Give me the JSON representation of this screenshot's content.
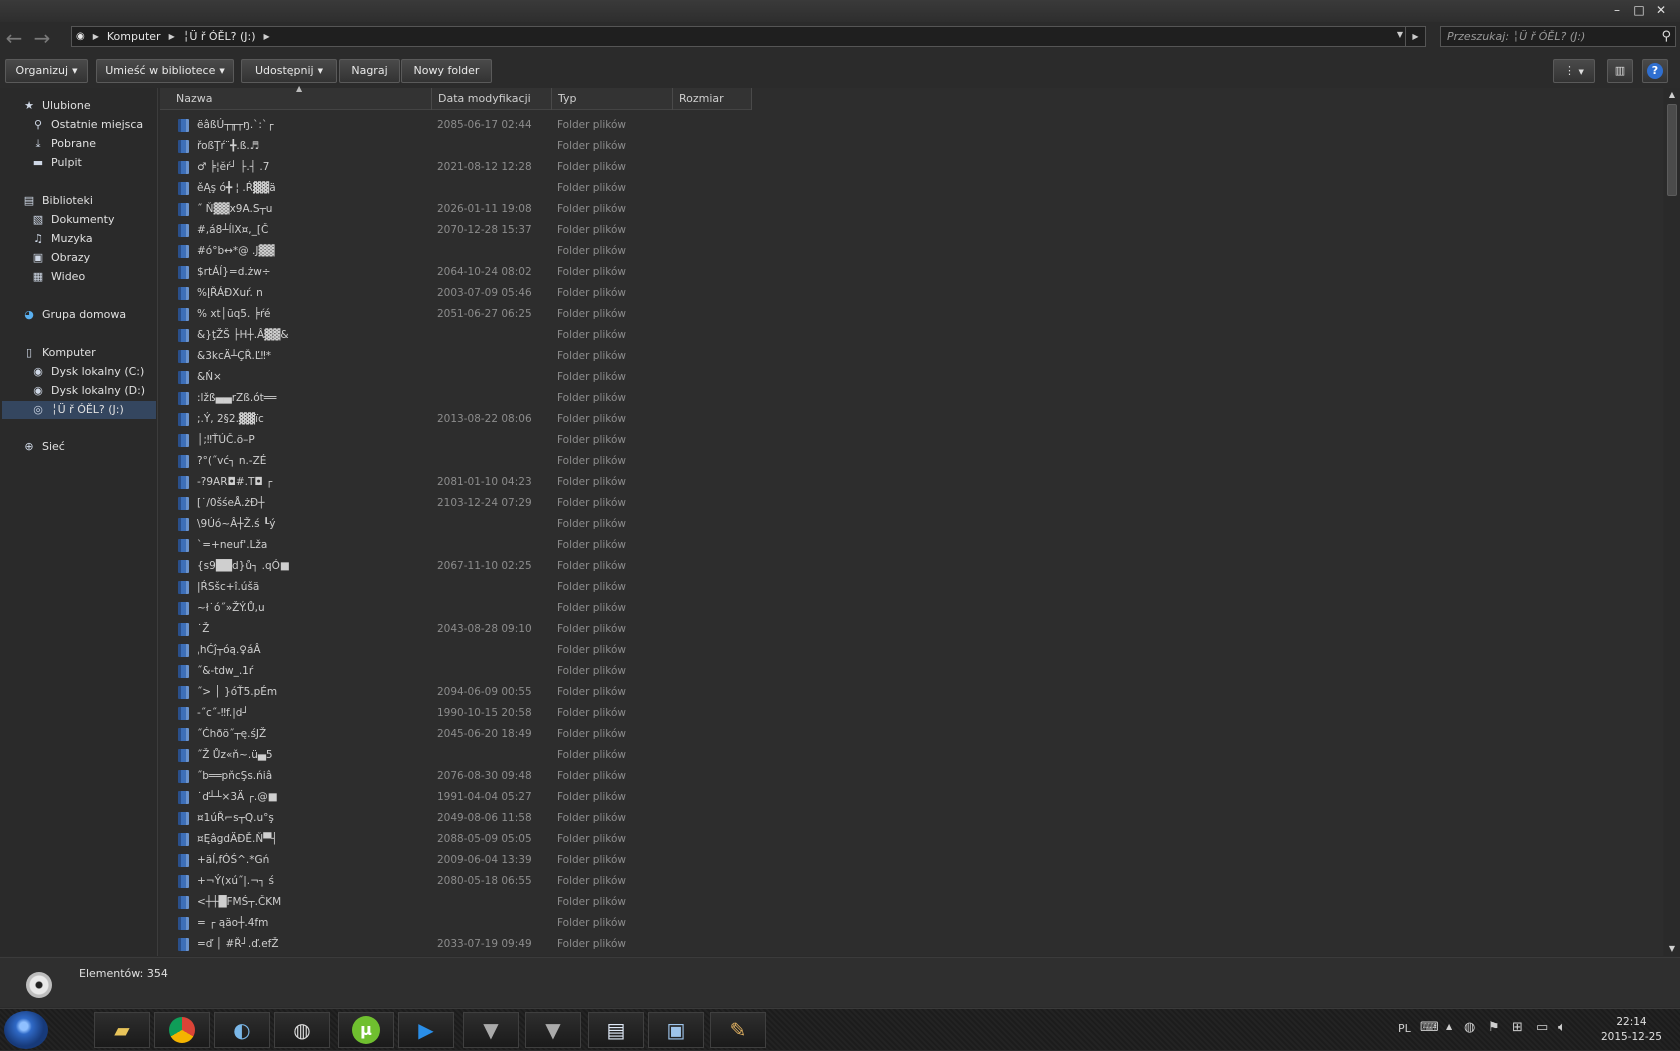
{
  "window": {
    "controls": [
      "–",
      "□",
      "✕"
    ]
  },
  "nav": {
    "back": "←",
    "forward": "→",
    "breadcrumb": [
      "Komputer",
      "╎Ü   ř ÓĚL? (J:)"
    ],
    "search_placeholder": "Przeszukaj: ╎Ü   ř ÓĚL? (J:)"
  },
  "toolbar": {
    "organize": "Organizuj",
    "library": "Umieść w bibliotece",
    "share": "Udostępnij",
    "burn": "Nagraj",
    "new_folder": "Nowy folder"
  },
  "navpane": {
    "favorites": "Ulubione",
    "recent": "Ostatnie miejsca",
    "downloads": "Pobrane",
    "desktop": "Pulpit",
    "libraries": "Biblioteki",
    "documents": "Dokumenty",
    "music": "Muzyka",
    "pictures": "Obrazy",
    "videos": "Wideo",
    "homegroup": "Grupa domowa",
    "computer": "Komputer",
    "disk_c": "Dysk lokalny (C:)",
    "disk_d": "Dysk lokalny (D:)",
    "disk_j": "╎Ü   ř ÓĚL? (J:)",
    "network": "Sieć"
  },
  "columns": {
    "name": "Nazwa",
    "date": "Data modyfikacji",
    "type": "Typ",
    "size": "Rozmiar"
  },
  "rows": [
    {
      "name": "ëâßÚ┬╥┬ŋ.`:`┌",
      "date": "2085-06-17 02:44",
      "type": "Folder plików"
    },
    {
      "name": "řoßŢŕ¨╋.ß.♬",
      "date": "",
      "type": "Folder plików"
    },
    {
      "name": "♂ ╞¦ĕŕ┘ ├.┤ .7",
      "date": "2021-08-12 12:28",
      "type": "Folder plików"
    },
    {
      "name": "ěĄş  ó╋  ¦ .Ŕ▓▓ä",
      "date": "",
      "type": "Folder plików"
    },
    {
      "name": " ˝ Ň▓▓x9A.S┬u",
      "date": "2026-01-11 19:08",
      "type": "Folder plików"
    },
    {
      "name": "#,á8┴ĺlX¤,_[Č",
      "date": "2070-12-28 15:37",
      "type": "Folder plików"
    },
    {
      "name": "#ó°b↔*@  .J▓▓",
      "date": "",
      "type": "Folder plików"
    },
    {
      "name": "$rtÁĺ}=d.żw÷",
      "date": "2064-10-24 08:02",
      "type": "Folder plików"
    },
    {
      "name": "%ĮŘÁĐXuŕ.     n",
      "date": "2003-07-09 05:46",
      "type": "Folder plików"
    },
    {
      "name": "%    xt│ūq5. ╞ŕé",
      "date": "2051-06-27 06:25",
      "type": "Folder plików"
    },
    {
      "name": "&}ţŽŠ ├H┼.Â▓▓&",
      "date": "",
      "type": "Folder plików"
    },
    {
      "name": "&3kcÄ┴ÇŘ.Ľ‼*",
      "date": "",
      "type": "Folder plików"
    },
    {
      "name": "&Ń×",
      "date": "",
      "type": "Folder plików"
    },
    {
      "name": ":lžß▄▄rZß.ót══",
      "date": "",
      "type": "Folder plików"
    },
    {
      "name": ";.Ý, 2§2.▓▓ïc",
      "date": "2013-08-22 08:06",
      "type": "Folder plików"
    },
    {
      "name": "│;‼ŤÚČ.ö–P",
      "date": "",
      "type": "Folder plików"
    },
    {
      "name": "?°(˝vć┐ n.-ZÉ",
      "date": "",
      "type": "Folder plików"
    },
    {
      "name": "-?9AR◘#.T◘ ┌",
      "date": "2081-01-10 04:23",
      "type": "Folder plików"
    },
    {
      "name": "[˙/0šśeÅ.żĐ┼",
      "date": "2103-12-24 07:29",
      "type": "Folder plików"
    },
    {
      "name": "\\9Úó~Â┼Ž.ś ┖ý",
      "date": "",
      "type": "Folder plików"
    },
    {
      "name": "`=+neuf'.Lža",
      "date": "",
      "type": "Folder plików"
    },
    {
      "name": "{s9██d}ů┐ .qÓ■",
      "date": "2067-11-10 02:25",
      "type": "Folder plików"
    },
    {
      "name": "|ŔSšc+î.úšä",
      "date": "",
      "type": "Folder plików"
    },
    {
      "name": "~ł˙ó˝»ŽÝ.Ů,u",
      "date": "",
      "type": "Folder plików"
    },
    {
      "name": "˙Ž",
      "date": "2043-08-28 09:10",
      "type": "Folder plików"
    },
    {
      "name": "ˌhĆĵ┬óą.♀áÂ",
      "date": "",
      "type": "Folder plików"
    },
    {
      "name": "˝&-tdw_.1ŕ",
      "date": "",
      "type": "Folder plików"
    },
    {
      "name": "˝> │ }óŤ5.pÉm",
      "date": "2094-06-09 00:55",
      "type": "Folder plików"
    },
    {
      "name": "-˝c˝-‼f.|d┘",
      "date": "1990-10-15 20:58",
      "type": "Folder plików"
    },
    {
      "name": "˝Ćhðö˝┬ę.śJŽ",
      "date": "2045-06-20 18:49",
      "type": "Folder plików"
    },
    {
      "name": "˝Ž   Ůz«ň~.ü▄5",
      "date": "",
      "type": "Folder plików"
    },
    {
      "name": "˝b══pňcŞs.ńiâ",
      "date": "2076-08-30 09:48",
      "type": "Folder plików"
    },
    {
      "name": "˙ď┴┴×3Ä ┌.@■",
      "date": "1991-04-04 05:27",
      "type": "Folder plików"
    },
    {
      "name": "¤1úŘ⌐s┬Q.u°ş",
      "date": "2049-08-06 11:58",
      "type": "Folder plików"
    },
    {
      "name": "¤ĘâgdÄĐĚ.Ň▀┤",
      "date": "2088-05-09 05:05",
      "type": "Folder plików"
    },
    {
      "name": "+äĺ,fÓŚ^.*Gń",
      "date": "2009-06-04 13:39",
      "type": "Folder plików"
    },
    {
      "name": "+¬Ý(xú˝|.¬┐ ś",
      "date": "2080-05-18 06:55",
      "type": "Folder plików"
    },
    {
      "name": "<┼┼█FMŚ┬.ČKM",
      "date": "",
      "type": "Folder plików"
    },
    {
      "name": "= ┌ ąäo┼.4fm",
      "date": "",
      "type": "Folder plików"
    },
    {
      "name": "=ď │ #Ř┘.ď.efŽ",
      "date": "2033-07-19 09:49",
      "type": "Folder plików"
    }
  ],
  "status": {
    "count": "Elementów: 354"
  },
  "tray": {
    "lang": "PL",
    "time": "22:14",
    "date": "2015-12-25"
  }
}
